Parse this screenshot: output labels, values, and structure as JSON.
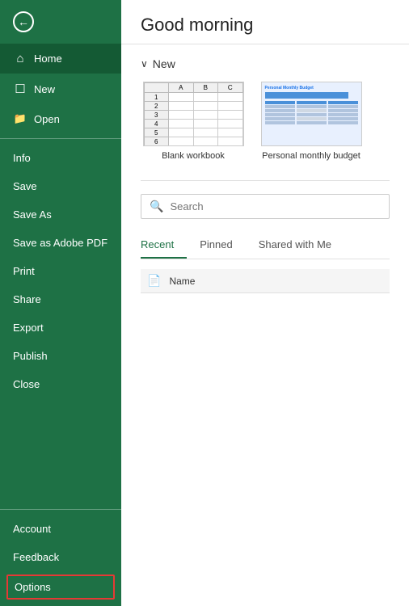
{
  "header": {
    "greeting": "Good morning"
  },
  "sidebar": {
    "back_icon": "←",
    "items_top": [
      {
        "id": "home",
        "label": "Home",
        "icon": "⌂",
        "active": true
      },
      {
        "id": "new",
        "label": "New",
        "icon": "☐"
      },
      {
        "id": "open",
        "label": "Open",
        "icon": "📂"
      }
    ],
    "items_mid": [
      {
        "id": "info",
        "label": "Info"
      },
      {
        "id": "save",
        "label": "Save"
      },
      {
        "id": "save-as",
        "label": "Save As"
      },
      {
        "id": "save-adobe",
        "label": "Save as Adobe PDF"
      },
      {
        "id": "print",
        "label": "Print"
      },
      {
        "id": "share",
        "label": "Share"
      },
      {
        "id": "export",
        "label": "Export"
      },
      {
        "id": "publish",
        "label": "Publish"
      },
      {
        "id": "close",
        "label": "Close"
      }
    ],
    "items_bottom": [
      {
        "id": "account",
        "label": "Account"
      },
      {
        "id": "feedback",
        "label": "Feedback"
      },
      {
        "id": "options",
        "label": "Options",
        "highlight": true
      }
    ]
  },
  "new_section": {
    "chevron": "∨",
    "title": "New",
    "templates": [
      {
        "id": "blank",
        "label": "Blank workbook"
      },
      {
        "id": "budget",
        "label": "Personal monthly budget"
      }
    ]
  },
  "search": {
    "placeholder": "Search",
    "icon": "🔍"
  },
  "tabs": [
    {
      "id": "recent",
      "label": "Recent",
      "active": true
    },
    {
      "id": "pinned",
      "label": "Pinned",
      "active": false
    },
    {
      "id": "shared",
      "label": "Shared with Me",
      "active": false
    }
  ],
  "file_list": {
    "col_name": "Name",
    "file_icon": "📄"
  },
  "colors": {
    "sidebar_bg": "#1e7145",
    "active_bg": "#145a34",
    "accent": "#1e7145",
    "options_border": "#e53935"
  }
}
